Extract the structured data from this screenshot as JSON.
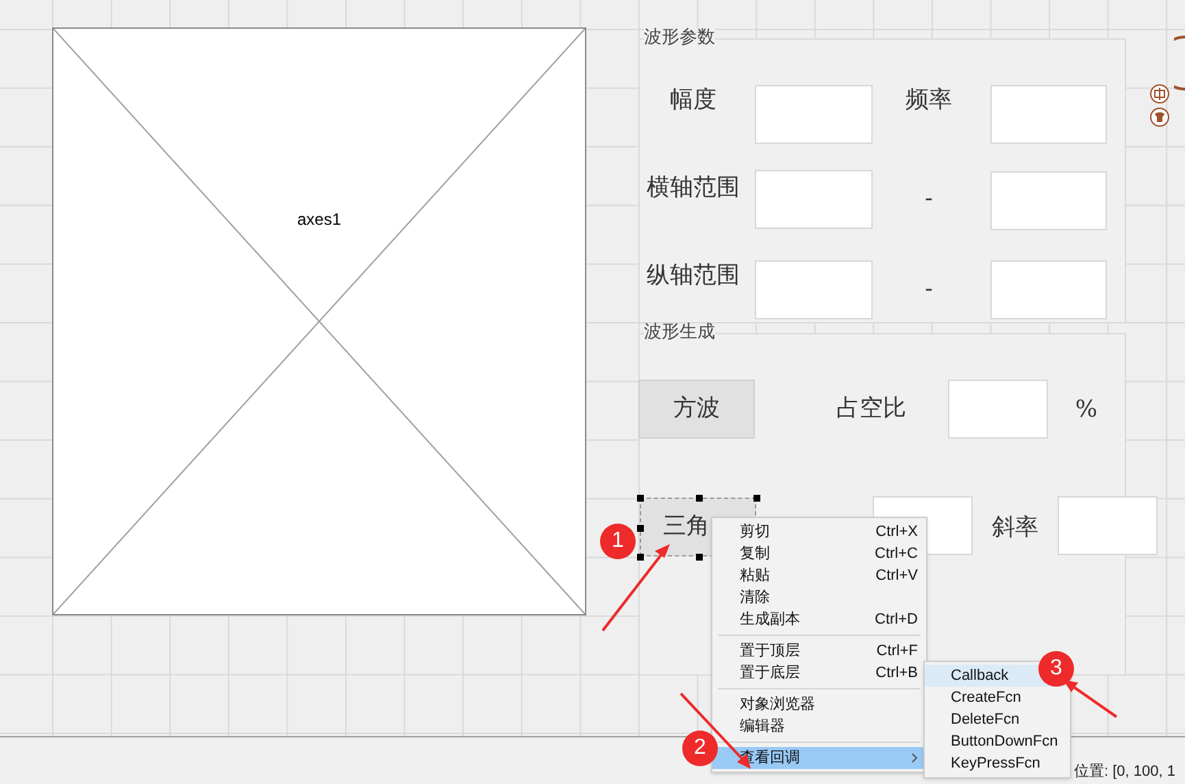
{
  "canvas": {
    "axes": {
      "label": "axes1"
    },
    "panels": [
      {
        "title": "波形参数"
      },
      {
        "title": "波形生成"
      }
    ],
    "controls": [
      {
        "kind": "label",
        "text": "幅度"
      },
      {
        "kind": "edit"
      },
      {
        "kind": "label",
        "text": "频率"
      },
      {
        "kind": "edit"
      },
      {
        "kind": "label",
        "text": "横轴范围"
      },
      {
        "kind": "edit"
      },
      {
        "kind": "label",
        "text": "-"
      },
      {
        "kind": "edit"
      },
      {
        "kind": "label",
        "text": "纵轴范围"
      },
      {
        "kind": "edit"
      },
      {
        "kind": "label",
        "text": "-"
      },
      {
        "kind": "edit"
      },
      {
        "kind": "button",
        "text": "方波",
        "selected": false
      },
      {
        "kind": "label",
        "text": "占空比"
      },
      {
        "kind": "edit"
      },
      {
        "kind": "label",
        "text": "%"
      },
      {
        "kind": "button",
        "text": "三角",
        "selected": true
      },
      {
        "kind": "edit"
      },
      {
        "kind": "label",
        "text": "斜率"
      },
      {
        "kind": "edit"
      }
    ]
  },
  "context_menu": {
    "items": [
      {
        "kind": "item",
        "label": "剪切",
        "shortcut": "Ctrl+X",
        "highlighted": false
      },
      {
        "kind": "item",
        "label": "复制",
        "shortcut": "Ctrl+C",
        "highlighted": false
      },
      {
        "kind": "item",
        "label": "粘贴",
        "shortcut": "Ctrl+V",
        "highlighted": false
      },
      {
        "kind": "item",
        "label": "清除",
        "highlighted": false
      },
      {
        "kind": "item",
        "label": "生成副本",
        "shortcut": "Ctrl+D",
        "highlighted": false
      },
      {
        "kind": "separator"
      },
      {
        "kind": "item",
        "label": "置于顶层",
        "shortcut": "Ctrl+F",
        "highlighted": false
      },
      {
        "kind": "item",
        "label": "置于底层",
        "shortcut": "Ctrl+B",
        "highlighted": false
      },
      {
        "kind": "separator"
      },
      {
        "kind": "item",
        "label": "对象浏览器",
        "highlighted": false
      },
      {
        "kind": "item",
        "label": "编辑器",
        "highlighted": false
      },
      {
        "kind": "separator"
      },
      {
        "kind": "submenu",
        "label": "查看回调",
        "highlighted": true
      }
    ]
  },
  "submenu": {
    "items": [
      {
        "label": "Callback",
        "highlighted": true
      },
      {
        "label": "CreateFcn",
        "highlighted": false
      },
      {
        "label": "DeleteFcn",
        "highlighted": false
      },
      {
        "label": "ButtonDownFcn",
        "highlighted": false
      },
      {
        "label": "KeyPressFcn",
        "highlighted": false
      }
    ]
  },
  "status_bar": {
    "position": "位置: [0, 100, 1"
  },
  "annotations": [
    "1",
    "2",
    "3"
  ]
}
